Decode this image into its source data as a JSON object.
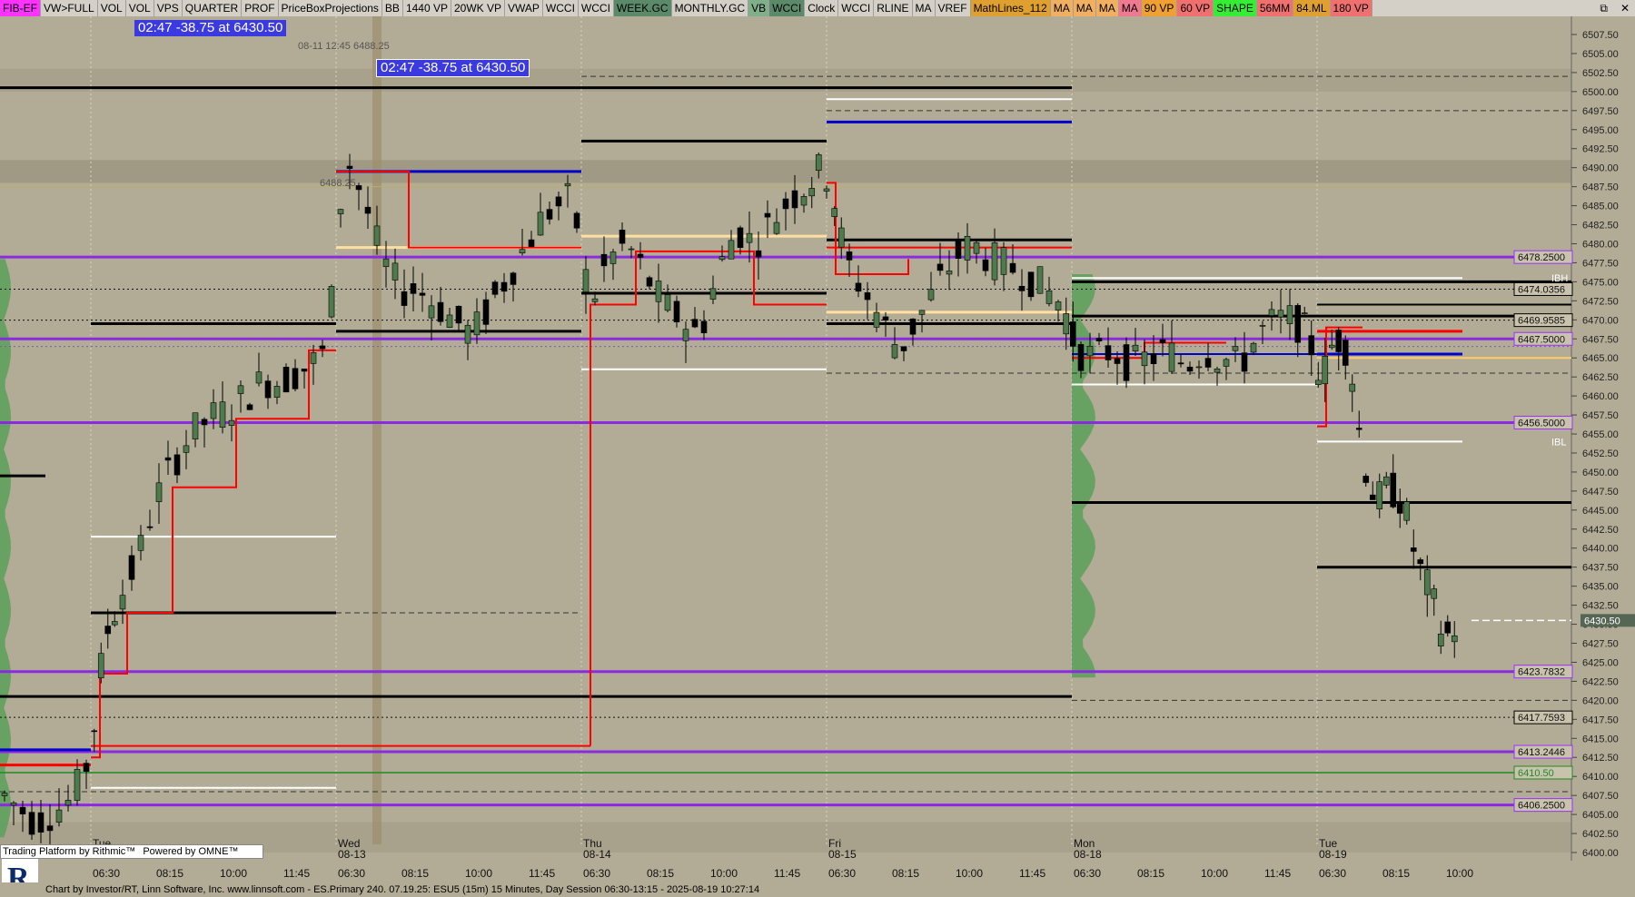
{
  "toolbar": {
    "buttons": [
      {
        "label": "FIB-EF",
        "bg": "#ff33ff"
      },
      {
        "label": "VW>FULL",
        "bg": "#d4d0c8"
      },
      {
        "label": "VOL",
        "bg": "#d4d0c8"
      },
      {
        "label": "VOL",
        "bg": "#d4d0c8"
      },
      {
        "label": "VPS",
        "bg": "#d4d0c8"
      },
      {
        "label": "QUARTER",
        "bg": "#d4d0c8"
      },
      {
        "label": "PROF",
        "bg": "#d4d0c8"
      },
      {
        "label": "PriceBoxProjections",
        "bg": "#d4d0c8"
      },
      {
        "label": "BB",
        "bg": "#d4d0c8"
      },
      {
        "label": "1440 VP",
        "bg": "#d4d0c8"
      },
      {
        "label": "20WK VP",
        "bg": "#d4d0c8"
      },
      {
        "label": "VWAP",
        "bg": "#d4d0c8"
      },
      {
        "label": "WCCI",
        "bg": "#d4d0c8"
      },
      {
        "label": "WCCI",
        "bg": "#d4d0c8"
      },
      {
        "label": "WEEK.GC",
        "bg": "#5a8a6a"
      },
      {
        "label": "MONTHLY.GC",
        "bg": "#d4d0c8"
      },
      {
        "label": "VB",
        "bg": "#7fb08a"
      },
      {
        "label": "WCCI",
        "bg": "#5a8a6a"
      },
      {
        "label": "Clock",
        "bg": "#d4d0c8"
      },
      {
        "label": "WCCI",
        "bg": "#d4d0c8"
      },
      {
        "label": "RLINE",
        "bg": "#d4d0c8"
      },
      {
        "label": "MA",
        "bg": "#d4d0c8"
      },
      {
        "label": "VREF",
        "bg": "#d4d0c8"
      },
      {
        "label": "MathLines_112",
        "bg": "#e0a030"
      },
      {
        "label": "MA",
        "bg": "#f0b060"
      },
      {
        "label": "MA",
        "bg": "#f0b060"
      },
      {
        "label": "MA",
        "bg": "#f0b060"
      },
      {
        "label": "MA",
        "bg": "#f07890"
      },
      {
        "label": "90 VP",
        "bg": "#f0a030"
      },
      {
        "label": "60 VP",
        "bg": "#f07070"
      },
      {
        "label": "SHAPE",
        "bg": "#33ee33"
      },
      {
        "label": "56MM",
        "bg": "#f07070"
      },
      {
        "label": "84.ML",
        "bg": "#e0a030"
      },
      {
        "label": "180 VP",
        "bg": "#f07070"
      }
    ],
    "window_controls": [
      "⧉",
      "✕"
    ]
  },
  "overlays": {
    "info_box_1": "02:47  -38.75 at 6430.50",
    "info_box_2": "02:47  -38.75 at 6430.50",
    "timestamp_note": "08-11 12:45 6488.25",
    "left_level_label": "6488.25"
  },
  "brand": {
    "platform_text": "Trading Platform by Rithmic™",
    "omne_text": "Powered by OMNE™"
  },
  "status_bar": {
    "text": "Chart by Investor/RT, Linn Software, Inc. www.linnsoft.com - ES.Primary 240.  07.19.25: ESU5 (15m) 15 Minutes, Day Session 06:30-13:15 - 2025-08-19 10:27:14"
  },
  "chart_data": {
    "type": "candlestick",
    "symbol": "ESU5",
    "interval": "15 Minutes",
    "ylim": [
      6400,
      6508
    ],
    "y_ticks": [
      6507.5,
      6505,
      6502.5,
      6500,
      6497.5,
      6495,
      6492.5,
      6490,
      6487.5,
      6485,
      6482.5,
      6480,
      6477.5,
      6475,
      6472.5,
      6470,
      6467.5,
      6465,
      6462.5,
      6460,
      6457.5,
      6455,
      6452.5,
      6450,
      6447.5,
      6445,
      6442.5,
      6440,
      6437.5,
      6435,
      6432.5,
      6430,
      6427.5,
      6425,
      6422.5,
      6420,
      6417.5,
      6415,
      6412.5,
      6410,
      6407.5,
      6405,
      6402.5,
      6400
    ],
    "x_tick_labels": [
      "06:30",
      "08:15",
      "10:00",
      "11:45",
      "06:30",
      "08:15",
      "10:00",
      "11:45",
      "06:30",
      "08:15",
      "10:00",
      "11:45",
      "06:30",
      "08:15",
      "10:00",
      "11:45",
      "06:30",
      "08:15",
      "10:00",
      "11:45",
      "06:30",
      "08:15",
      "10:00"
    ],
    "day_labels": [
      {
        "day": "Tue",
        "date": ""
      },
      {
        "day": "Wed",
        "date": "08-13"
      },
      {
        "day": "Thu",
        "date": "08-14"
      },
      {
        "day": "Fri",
        "date": "08-15"
      },
      {
        "day": "Mon",
        "date": "08-18"
      },
      {
        "day": "Tue",
        "date": "08-19"
      }
    ],
    "last_price": "6430.50",
    "level_tags": [
      {
        "label": "6478.2500",
        "price": 6478.25,
        "color": "#9b30ff"
      },
      {
        "label": "IBH",
        "price": 6475.5,
        "color": "#ffffff"
      },
      {
        "label": "6474.0356",
        "price": 6474.04,
        "color": "#000000"
      },
      {
        "label": "6469.9585",
        "price": 6469.96,
        "color": "#000000"
      },
      {
        "label": "6467.5000",
        "price": 6467.5,
        "color": "#9b30ff"
      },
      {
        "label": "6456.5000",
        "price": 6456.5,
        "color": "#9b30ff"
      },
      {
        "label": "IBL",
        "price": 6454.0,
        "color": "#ffffff"
      },
      {
        "label": "6423.7832",
        "price": 6423.78,
        "color": "#9b30ff"
      },
      {
        "label": "6417.7593",
        "price": 6417.76,
        "color": "#000000"
      },
      {
        "label": "6413.2446",
        "price": 6413.24,
        "color": "#9b30ff"
      },
      {
        "label": "6410.50",
        "price": 6410.5,
        "color": "#228b22"
      },
      {
        "label": "6406.2500",
        "price": 6406.25,
        "color": "#9b30ff"
      }
    ],
    "colors": {
      "background": "#b2ab96",
      "up_candle": "#4e7a4e",
      "down_candle": "#000000",
      "purple_level": "#8a2be2",
      "vwap": "#ff0000",
      "pivot": "#0000ff"
    }
  }
}
